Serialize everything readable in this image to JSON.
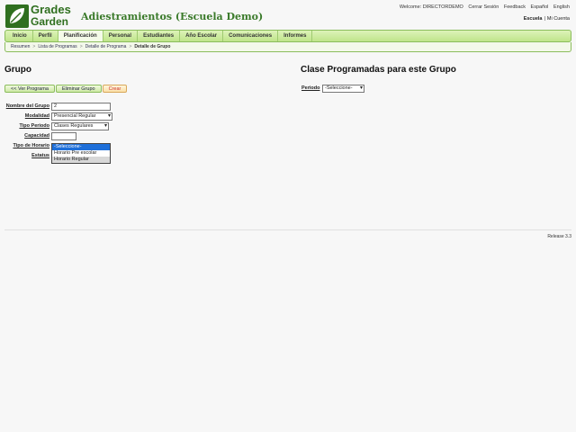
{
  "header": {
    "logo_line1": "Grades",
    "logo_line2": "Garden",
    "app_title": "Adiestramientos (Escuela Demo)",
    "top_links": [
      "Welcome: DIRECTORDEMO",
      "Cerrar Sesión",
      "Feedback",
      "Español",
      "English"
    ],
    "school_label": "Escuela",
    "separator": "|",
    "account_label": "Mi Cuenta"
  },
  "nav": {
    "tabs": [
      "Inicio",
      "Perfil",
      "Planificación",
      "Personal",
      "Estudiantes",
      "Año Escolar",
      "Comunicaciones",
      "Informes"
    ],
    "active": "Planificación"
  },
  "breadcrumb": {
    "items": [
      "Resumen",
      "Lista de Programas",
      "Detalle de Programa",
      "Detalle de Grupo"
    ],
    "separator": ">"
  },
  "group": {
    "title": "Grupo",
    "buttons": {
      "back": "<< Ver Programa",
      "delete": "Eliminar Grupo",
      "create": "Crear"
    },
    "fields": {
      "nombre_label": "Nombre del Grupo",
      "nombre_value": "2",
      "modalidad_label": "Modalidad",
      "modalidad_value": "Presencial Regular",
      "tipo_periodo_label": "Tipo Periodo",
      "tipo_periodo_value": "Clases Regulares",
      "capacidad_label": "Capacidad",
      "capacidad_value": "",
      "tipo_horario_label": "Tipo de Horario",
      "estatus_label": "Estatus",
      "tipo_horario_options": [
        "-Seleccione-",
        "Horario Pre escolar",
        "Horario Regular"
      ],
      "tipo_horario_selected": "-Seleccione-"
    }
  },
  "scheduled": {
    "title": "Clase Programadas para este Grupo",
    "periodo_label": "Periodo",
    "periodo_value": "-Seleccione-"
  },
  "footer": {
    "release": "Release 3.3"
  },
  "colors": {
    "brand_green": "#2f6f1f",
    "nav_green": "#bfe48a",
    "create_orange": "#fbe0a8",
    "selection_blue": "#1e6fd9"
  },
  "icons": {
    "logo": "leaf-icon",
    "dropdown": "chevron-down-icon"
  }
}
